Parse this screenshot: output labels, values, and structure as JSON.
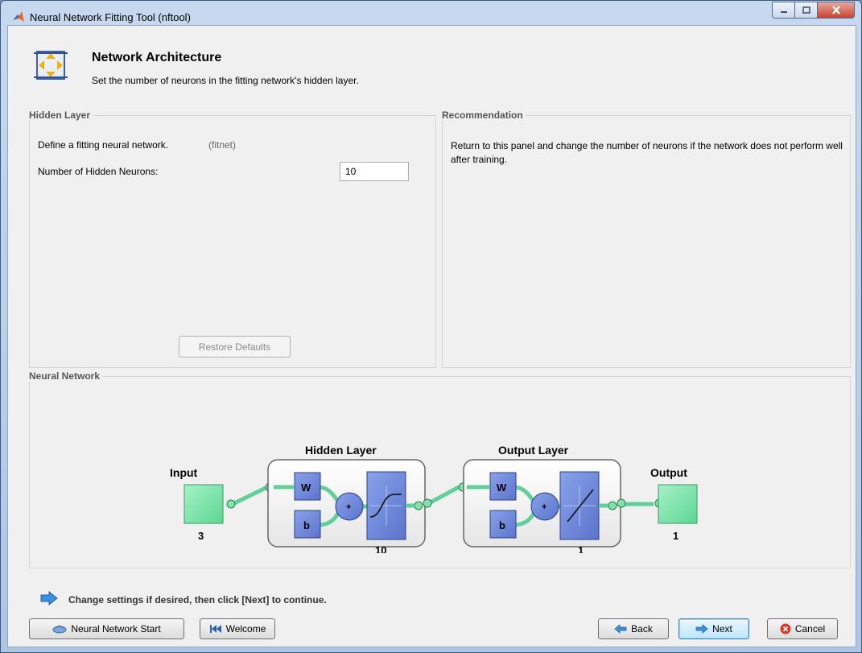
{
  "window": {
    "title": "Neural Network Fitting Tool (nftool)"
  },
  "header": {
    "title": "Network Architecture",
    "subtitle": "Set the number of neurons in the fitting network's hidden layer."
  },
  "hidden_layer_panel": {
    "title": "Hidden Layer",
    "description": "Define a fitting neural network.",
    "function_name": "(fitnet)",
    "neurons_label": "Number of Hidden Neurons:",
    "neurons_value": "10",
    "restore_label": "Restore Defaults"
  },
  "recommendation_panel": {
    "title": "Recommendation",
    "text": "Return to this panel and change the number of neurons if the network does not perform well after training."
  },
  "network_panel": {
    "title": "Neural Network",
    "input_label": "Input",
    "input_size": "3",
    "hidden_layer_label": "Hidden Layer",
    "hidden_size": "10",
    "output_layer_label": "Output Layer",
    "output_layer_size": "1",
    "output_label": "Output",
    "output_size": "1",
    "weight_symbol": "W",
    "bias_symbol": "b",
    "sum_symbol": "+"
  },
  "footer": {
    "hint": "Change settings  if desired, then click [Next] to continue.",
    "start_label": "Neural Network Start",
    "welcome_label": "Welcome",
    "back_label": "Back",
    "next_label": "Next",
    "cancel_label": "Cancel"
  },
  "colors": {
    "neuron_block": "#6b86d8",
    "io_block": "#7ee3a8",
    "connector": "#5fd09a"
  },
  "icons": [
    "matlab-logo-icon",
    "minimize-icon",
    "maximize-icon",
    "close-icon",
    "architecture-icon",
    "arrow-right-icon",
    "network-icon",
    "rewind-icon",
    "back-arrow-icon",
    "next-arrow-icon",
    "cancel-icon"
  ]
}
